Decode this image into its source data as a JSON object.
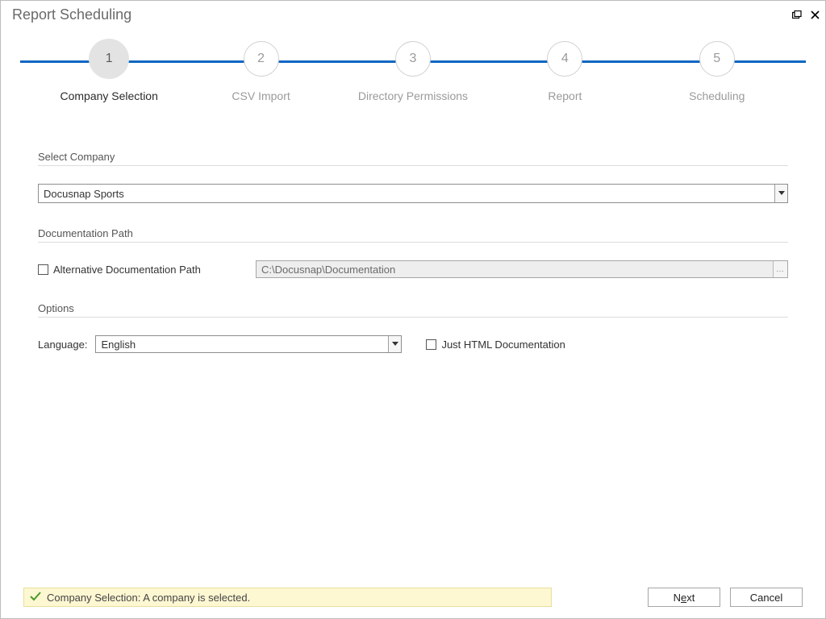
{
  "window": {
    "title": "Report Scheduling"
  },
  "stepper": {
    "steps": [
      {
        "num": "1",
        "label": "Company Selection",
        "active": true
      },
      {
        "num": "2",
        "label": "CSV Import",
        "active": false
      },
      {
        "num": "3",
        "label": "Directory Permissions",
        "active": false
      },
      {
        "num": "4",
        "label": "Report",
        "active": false
      },
      {
        "num": "5",
        "label": "Scheduling",
        "active": false
      }
    ]
  },
  "sections": {
    "select_company": "Select Company",
    "documentation_path": "Documentation Path",
    "options": "Options"
  },
  "company": {
    "selected": "Docusnap Sports"
  },
  "doc_path": {
    "checkbox_label": "Alternative Documentation Path",
    "value": "C:\\Docusnap\\Documentation"
  },
  "options": {
    "language_label": "Language:",
    "language_value": "English",
    "just_html_label": "Just HTML Documentation"
  },
  "status": {
    "text": "Company Selection: A company is selected."
  },
  "buttons": {
    "next_pre": "N",
    "next_ul": "e",
    "next_post": "xt",
    "cancel": "Cancel"
  }
}
